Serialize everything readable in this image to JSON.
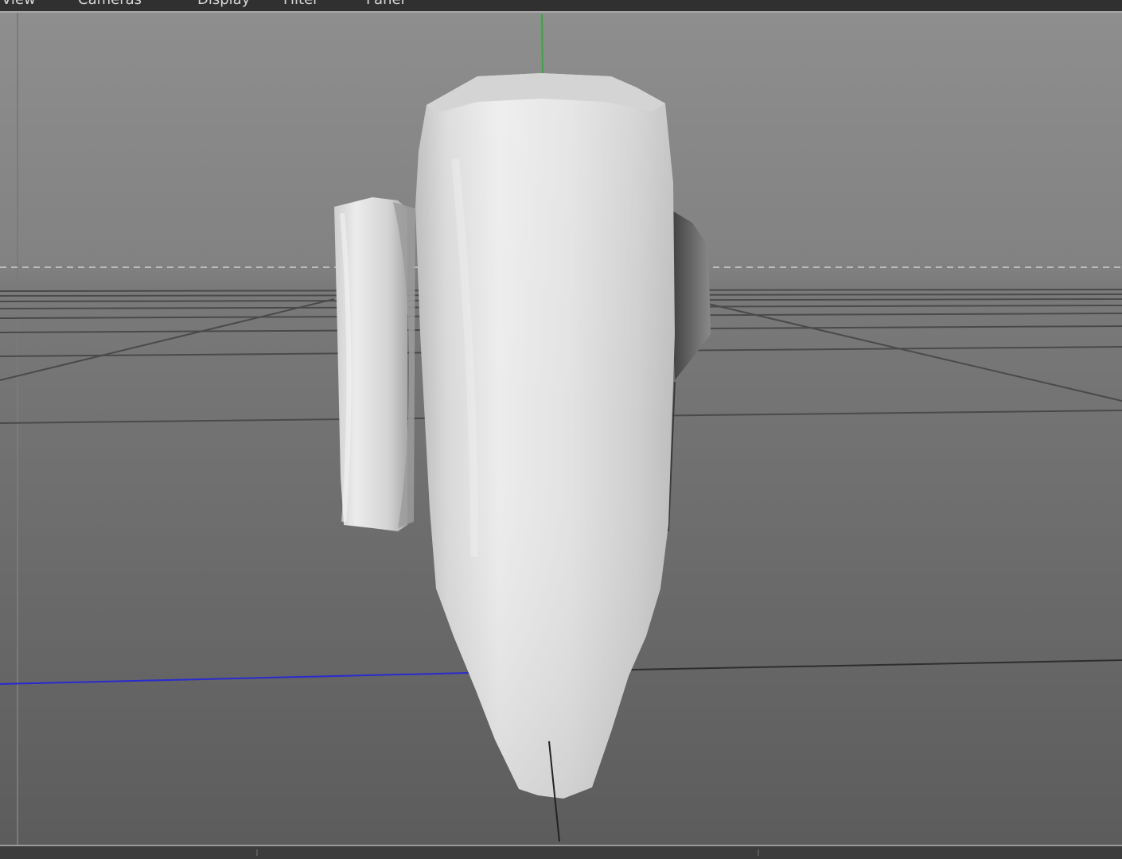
{
  "menubar": {
    "items": [
      {
        "label": "View",
        "icon": "none"
      },
      {
        "label": "Cameras",
        "icon": "none"
      },
      {
        "label": "Display",
        "icon": "none"
      },
      {
        "label": "Filter",
        "icon": "none"
      },
      {
        "label": "Panel",
        "icon": "none"
      }
    ]
  },
  "viewport": {
    "axis_colors": {
      "y_axis": "#2fae3a",
      "z_axis": "#2a2ad0",
      "grid": "#3f3f3f"
    },
    "background": {
      "top": "#8c8c8c",
      "bottom": "#5e5e5e"
    },
    "object": {
      "name": "lathe-object",
      "shading": "#e6e6e6"
    }
  }
}
